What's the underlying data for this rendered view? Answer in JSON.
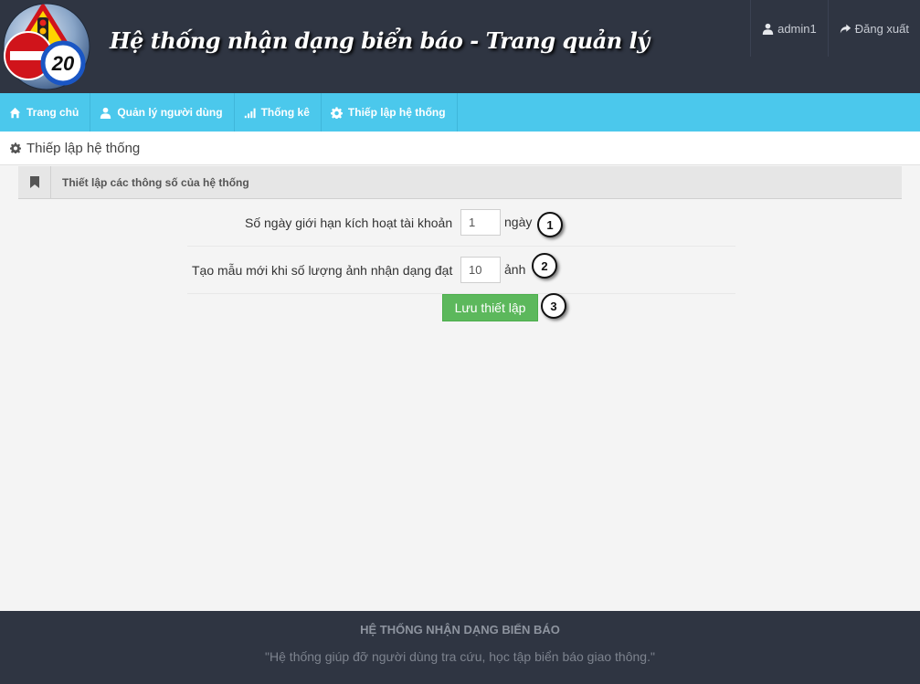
{
  "header": {
    "title": "Hệ thống nhận dạng biển báo - Trang quản lý",
    "logo_sign_number": "20",
    "user_label": "admin1",
    "logout_label": "Đăng xuất"
  },
  "nav": {
    "items": [
      {
        "label": "Trang chủ",
        "icon": "home-icon"
      },
      {
        "label": "Quản lý người dùng",
        "icon": "user-icon"
      },
      {
        "label": "Thống kê",
        "icon": "signal-icon"
      },
      {
        "label": "Thiếp lập hệ thống",
        "icon": "gear-icon"
      }
    ]
  },
  "breadcrumb": {
    "label": "Thiếp lập hệ thống"
  },
  "panel": {
    "title": "Thiết lập các thông số của hệ thống"
  },
  "form": {
    "activation_days": {
      "label": "Số ngày giới hạn kích hoạt tài khoản",
      "value": "1",
      "unit": "ngày",
      "marker": "1"
    },
    "sample_threshold": {
      "label": "Tạo mẫu mới khi số lượng ảnh nhận dạng đạt",
      "value": "10",
      "unit": "ảnh",
      "marker": "2"
    },
    "save": {
      "label": "Lưu thiết lập",
      "marker": "3"
    }
  },
  "footer": {
    "title": "HỆ THỐNG NHẬN DẠNG BIỂN BÁO",
    "tagline": "\"Hệ thống giúp đỡ người dùng tra cứu, học tập biển báo giao thông.\""
  },
  "colors": {
    "header_bg": "#2f3542",
    "nav_bg": "#4bc8ec",
    "save_button": "#5cb85c"
  }
}
